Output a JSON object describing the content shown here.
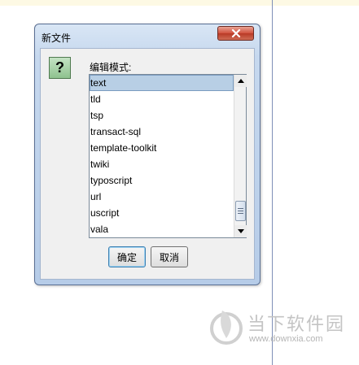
{
  "dialog": {
    "title": "新文件",
    "close_icon": "close-icon",
    "help_icon": "question-icon",
    "help_glyph": "?",
    "label": "编辑模式:",
    "modes": [
      "text",
      "tld",
      "tsp",
      "transact-sql",
      "template-toolkit",
      "twiki",
      "typoscript",
      "url",
      "uscript",
      "vala"
    ],
    "selected_index": 0,
    "ok_label": "确定",
    "cancel_label": "取消"
  },
  "watermark": {
    "brand": "当下软件园",
    "url": "www.downxia.com"
  },
  "colors": {
    "selection": "#b8cfe5",
    "close_button": "#d0503c",
    "help_icon_bg": "#8fc28f"
  }
}
